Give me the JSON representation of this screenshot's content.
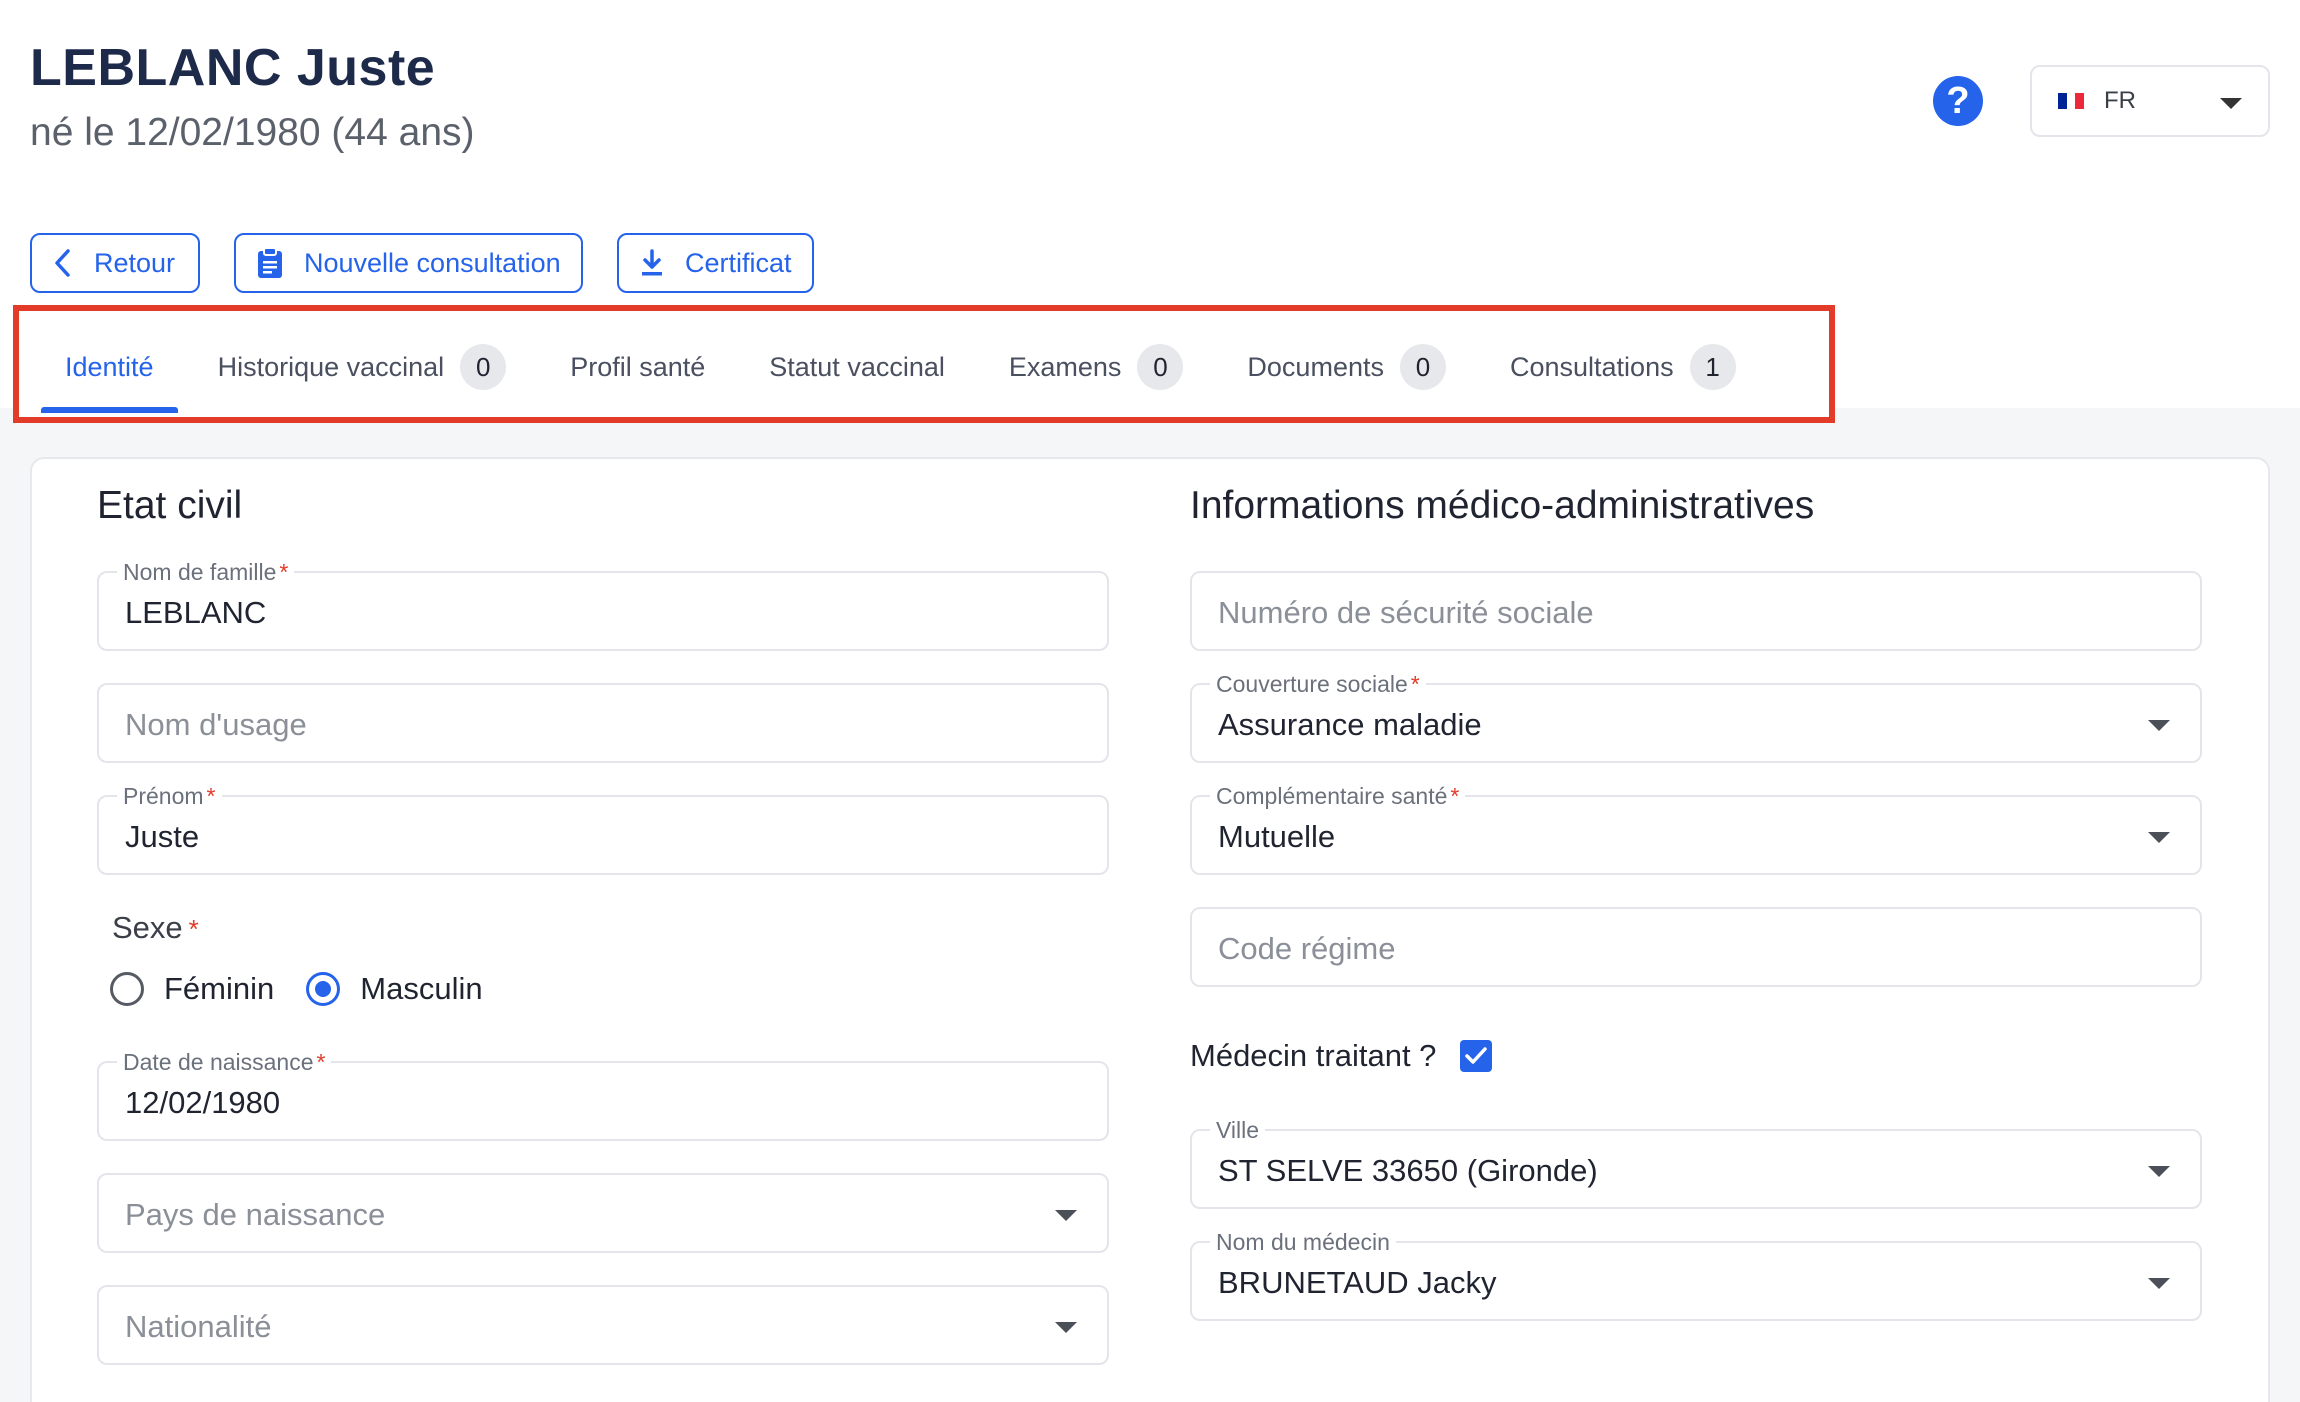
{
  "patient": {
    "name": "LEBLANC Juste",
    "birth_info": "né le 12/02/1980 (44 ans)"
  },
  "header": {
    "help_label": "?",
    "language": "FR",
    "flag_colors": [
      "#002395",
      "#ffffff",
      "#ED2939"
    ]
  },
  "actions": {
    "back_label": "Retour",
    "new_consultation_label": "Nouvelle consultation",
    "certificate_label": "Certificat"
  },
  "tabs": [
    {
      "label": "Identité",
      "active": true
    },
    {
      "label": "Historique vaccinal",
      "badge": "0"
    },
    {
      "label": "Profil santé"
    },
    {
      "label": "Statut vaccinal"
    },
    {
      "label": "Examens",
      "badge": "0"
    },
    {
      "label": "Documents",
      "badge": "0"
    },
    {
      "label": "Consultations",
      "badge": "1"
    }
  ],
  "etat_civil": {
    "title": "Etat civil",
    "nom_famille": {
      "label": "Nom de famille",
      "required_mark": "*",
      "value": "LEBLANC"
    },
    "nom_usage": {
      "placeholder": "Nom d'usage"
    },
    "prenom": {
      "label": "Prénom",
      "required_mark": "*",
      "value": "Juste"
    },
    "sexe": {
      "label": "Sexe",
      "required_mark": "*",
      "options": [
        {
          "label": "Féminin",
          "checked": false
        },
        {
          "label": "Masculin",
          "checked": true
        }
      ]
    },
    "date_naissance": {
      "label": "Date de naissance",
      "required_mark": "*",
      "value": "12/02/1980"
    },
    "pays_naissance": {
      "placeholder": "Pays de naissance"
    },
    "nationalite": {
      "placeholder": "Nationalité"
    }
  },
  "medico_admin": {
    "title": "Informations médico-administratives",
    "securite_sociale": {
      "placeholder": "Numéro de sécurité sociale"
    },
    "couverture": {
      "label": "Couverture sociale",
      "required_mark": "*",
      "value": "Assurance maladie"
    },
    "complementaire": {
      "label": "Complémentaire santé",
      "required_mark": "*",
      "value": "Mutuelle"
    },
    "code_regime": {
      "placeholder": "Code régime"
    },
    "medecin_traitant": {
      "label": "Médecin traitant ?",
      "checked": true
    },
    "ville": {
      "label": "Ville",
      "value": "ST SELVE 33650 (Gironde)"
    },
    "nom_medecin": {
      "label": "Nom du médecin",
      "value": "BRUNETAUD Jacky"
    }
  },
  "colors": {
    "accent": "#2563eb",
    "highlight_border": "#e23b2a",
    "required": "#e23b2a"
  }
}
